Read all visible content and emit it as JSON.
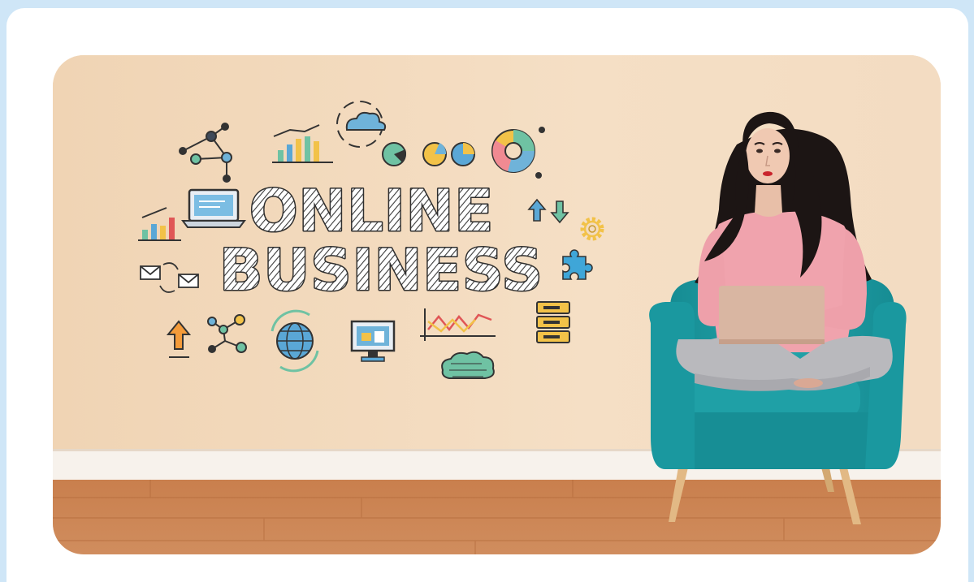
{
  "image": {
    "wall_text_line1": "ONLINE",
    "wall_text_line2": "BUSINESS"
  },
  "colors": {
    "page_background": "#cfe6f7",
    "card_background": "#ffffff",
    "wall": "#f3dcc0",
    "floor": "#c9804f",
    "chair": "#1f9aa0",
    "sweater": "#f0a3ad",
    "laptop": "#d9b6a2"
  }
}
